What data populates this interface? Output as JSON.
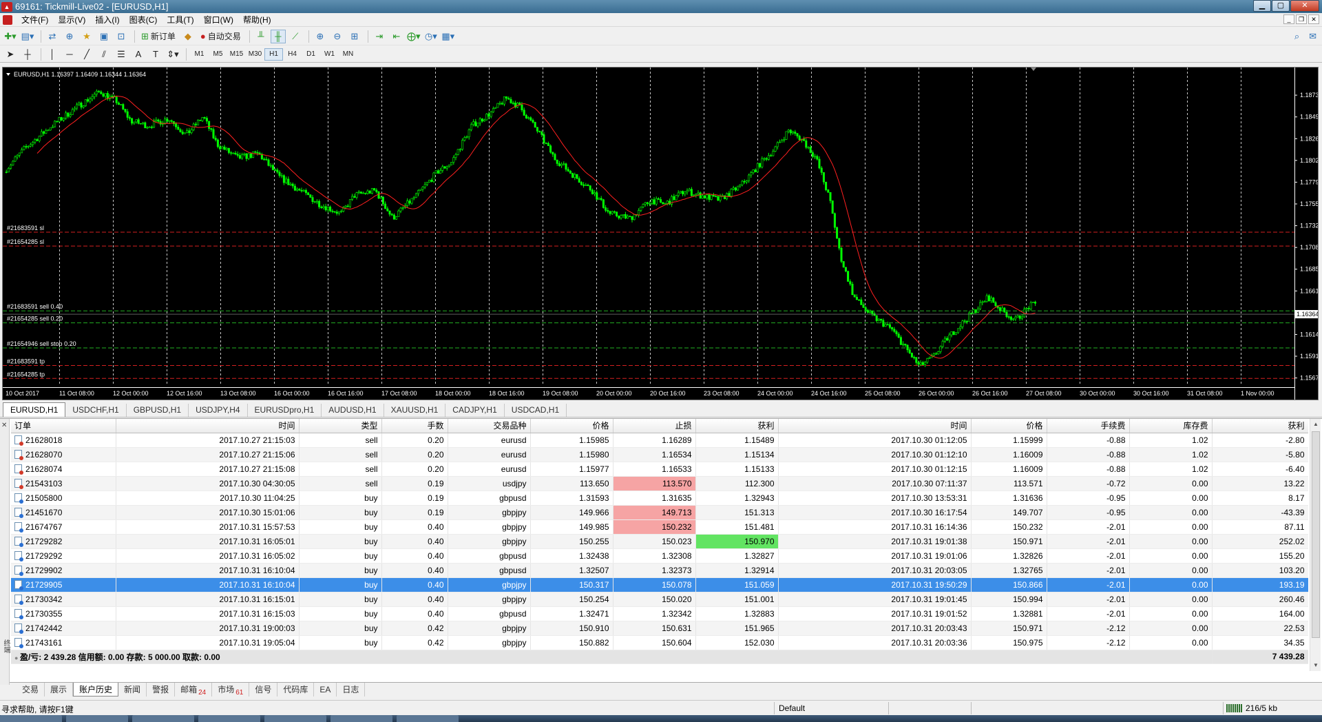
{
  "window": {
    "title": "69161: Tickmill-Live02 - [EURUSD,H1]",
    "icon": "mt4-icon",
    "controls": [
      "minimize",
      "maximize",
      "close"
    ]
  },
  "menu": [
    "文件(F)",
    "显示(V)",
    "插入(I)",
    "图表(C)",
    "工具(T)",
    "窗口(W)",
    "帮助(H)"
  ],
  "toolbar": {
    "new_order_label": "新订单",
    "autotrade_label": "自动交易",
    "timeframes": [
      "M1",
      "M5",
      "M15",
      "M30",
      "H1",
      "H4",
      "D1",
      "W1",
      "MN"
    ],
    "active_timeframe": "H1"
  },
  "chart": {
    "header": "EURUSD,H1  1.16397 1.16409 1.16344 1.16364",
    "current_price": "1.16364",
    "price_labels": [
      "1.18730",
      "1.18495",
      "1.18260",
      "1.18025",
      "1.17790",
      "1.17555",
      "1.17320",
      "1.17085",
      "1.16850",
      "1.16615",
      "1.16380",
      "1.16145",
      "1.15910",
      "1.15675"
    ],
    "time_labels": [
      "10 Oct 2017",
      "11 Oct 08:00",
      "12 Oct 00:00",
      "12 Oct 16:00",
      "13 Oct 08:00",
      "16 Oct 00:00",
      "16 Oct 16:00",
      "17 Oct 08:00",
      "18 Oct 00:00",
      "18 Oct 16:00",
      "19 Oct 08:00",
      "20 Oct 00:00",
      "20 Oct 16:00",
      "23 Oct 08:00",
      "24 Oct 00:00",
      "24 Oct 16:00",
      "25 Oct 08:00",
      "26 Oct 00:00",
      "26 Oct 16:00",
      "27 Oct 08:00",
      "30 Oct 00:00",
      "30 Oct 16:00",
      "31 Oct 08:00",
      "1 Nov 00:00"
    ],
    "order_lines": [
      {
        "label": "#21683591 sl",
        "price": 1.1725,
        "color": "#d42020"
      },
      {
        "label": "#21654285 sl",
        "price": 1.171,
        "color": "#d42020"
      },
      {
        "label": "#21683591 sell 0.40",
        "price": 1.164,
        "color": "#22b022"
      },
      {
        "label": "#21654285 sell 0.20",
        "price": 1.1627,
        "color": "#22b022"
      },
      {
        "label": "#21654946 sell stop 0.20",
        "price": 1.16,
        "color": "#22b022"
      },
      {
        "label": "#21683591 tp",
        "price": 1.1581,
        "color": "#d42020"
      },
      {
        "label": "#21654285 tp",
        "price": 1.1567,
        "color": "#d42020"
      }
    ],
    "candle_color": "#00ff00",
    "ma_color": "#ff2020"
  },
  "chart_tabs": [
    "EURUSD,H1",
    "USDCHF,H1",
    "GBPUSD,H1",
    "USDJPY,H4",
    "EURUSDpro,H1",
    "AUDUSD,H1",
    "XAUUSD,H1",
    "CADJPY,H1",
    "USDCAD,H1"
  ],
  "active_chart_tab": 0,
  "history": {
    "columns": [
      "订单",
      "时间",
      "类型",
      "手数",
      "交易品种",
      "价格",
      "止损",
      "获利",
      "时间",
      "价格",
      "手续费",
      "库存费",
      "获利"
    ],
    "rows": [
      {
        "order": "21628018",
        "open_time": "2017.10.27 21:15:03",
        "type": "sell",
        "lots": "0.20",
        "symbol": "eurusd",
        "open_price": "1.15985",
        "sl": "1.16289",
        "tp": "1.15489",
        "close_time": "2017.10.30 01:12:05",
        "close_price": "1.15999",
        "commission": "-0.88",
        "swap": "1.02",
        "profit": "-2.80",
        "sl_hit": false,
        "tp_hit": false
      },
      {
        "order": "21628070",
        "open_time": "2017.10.27 21:15:06",
        "type": "sell",
        "lots": "0.20",
        "symbol": "eurusd",
        "open_price": "1.15980",
        "sl": "1.16534",
        "tp": "1.15134",
        "close_time": "2017.10.30 01:12:10",
        "close_price": "1.16009",
        "commission": "-0.88",
        "swap": "1.02",
        "profit": "-5.80",
        "sl_hit": false,
        "tp_hit": false
      },
      {
        "order": "21628074",
        "open_time": "2017.10.27 21:15:08",
        "type": "sell",
        "lots": "0.20",
        "symbol": "eurusd",
        "open_price": "1.15977",
        "sl": "1.16533",
        "tp": "1.15133",
        "close_time": "2017.10.30 01:12:15",
        "close_price": "1.16009",
        "commission": "-0.88",
        "swap": "1.02",
        "profit": "-6.40",
        "sl_hit": false,
        "tp_hit": false
      },
      {
        "order": "21543103",
        "open_time": "2017.10.30 04:30:05",
        "type": "sell",
        "lots": "0.19",
        "symbol": "usdjpy",
        "open_price": "113.650",
        "sl": "113.570",
        "tp": "112.300",
        "close_time": "2017.10.30 07:11:37",
        "close_price": "113.571",
        "commission": "-0.72",
        "swap": "0.00",
        "profit": "13.22",
        "sl_hit": true,
        "tp_hit": false
      },
      {
        "order": "21505800",
        "open_time": "2017.10.30 11:04:25",
        "type": "buy",
        "lots": "0.19",
        "symbol": "gbpusd",
        "open_price": "1.31593",
        "sl": "1.31635",
        "tp": "1.32943",
        "close_time": "2017.10.30 13:53:31",
        "close_price": "1.31636",
        "commission": "-0.95",
        "swap": "0.00",
        "profit": "8.17",
        "sl_hit": false,
        "tp_hit": false
      },
      {
        "order": "21451670",
        "open_time": "2017.10.30 15:01:06",
        "type": "buy",
        "lots": "0.19",
        "symbol": "gbpjpy",
        "open_price": "149.966",
        "sl": "149.713",
        "tp": "151.313",
        "close_time": "2017.10.30 16:17:54",
        "close_price": "149.707",
        "commission": "-0.95",
        "swap": "0.00",
        "profit": "-43.39",
        "sl_hit": true,
        "tp_hit": false
      },
      {
        "order": "21674767",
        "open_time": "2017.10.31 15:57:53",
        "type": "buy",
        "lots": "0.40",
        "symbol": "gbpjpy",
        "open_price": "149.985",
        "sl": "150.232",
        "tp": "151.481",
        "close_time": "2017.10.31 16:14:36",
        "close_price": "150.232",
        "commission": "-2.01",
        "swap": "0.00",
        "profit": "87.11",
        "sl_hit": true,
        "tp_hit": false
      },
      {
        "order": "21729282",
        "open_time": "2017.10.31 16:05:01",
        "type": "buy",
        "lots": "0.40",
        "symbol": "gbpjpy",
        "open_price": "150.255",
        "sl": "150.023",
        "tp": "150.970",
        "close_time": "2017.10.31 19:01:38",
        "close_price": "150.971",
        "commission": "-2.01",
        "swap": "0.00",
        "profit": "252.02",
        "sl_hit": false,
        "tp_hit": true
      },
      {
        "order": "21729292",
        "open_time": "2017.10.31 16:05:02",
        "type": "buy",
        "lots": "0.40",
        "symbol": "gbpusd",
        "open_price": "1.32438",
        "sl": "1.32308",
        "tp": "1.32827",
        "close_time": "2017.10.31 19:01:06",
        "close_price": "1.32826",
        "commission": "-2.01",
        "swap": "0.00",
        "profit": "155.20",
        "sl_hit": false,
        "tp_hit": false
      },
      {
        "order": "21729902",
        "open_time": "2017.10.31 16:10:04",
        "type": "buy",
        "lots": "0.40",
        "symbol": "gbpusd",
        "open_price": "1.32507",
        "sl": "1.32373",
        "tp": "1.32914",
        "close_time": "2017.10.31 20:03:05",
        "close_price": "1.32765",
        "commission": "-2.01",
        "swap": "0.00",
        "profit": "103.20",
        "sl_hit": false,
        "tp_hit": false
      },
      {
        "order": "21729905",
        "open_time": "2017.10.31 16:10:04",
        "type": "buy",
        "lots": "0.40",
        "symbol": "gbpjpy",
        "open_price": "150.317",
        "sl": "150.078",
        "tp": "151.059",
        "close_time": "2017.10.31 19:50:29",
        "close_price": "150.866",
        "commission": "-2.01",
        "swap": "0.00",
        "profit": "193.19",
        "sl_hit": false,
        "tp_hit": false,
        "selected": true
      },
      {
        "order": "21730342",
        "open_time": "2017.10.31 16:15:01",
        "type": "buy",
        "lots": "0.40",
        "symbol": "gbpjpy",
        "open_price": "150.254",
        "sl": "150.020",
        "tp": "151.001",
        "close_time": "2017.10.31 19:01:45",
        "close_price": "150.994",
        "commission": "-2.01",
        "swap": "0.00",
        "profit": "260.46",
        "sl_hit": false,
        "tp_hit": false
      },
      {
        "order": "21730355",
        "open_time": "2017.10.31 16:15:03",
        "type": "buy",
        "lots": "0.40",
        "symbol": "gbpusd",
        "open_price": "1.32471",
        "sl": "1.32342",
        "tp": "1.32883",
        "close_time": "2017.10.31 19:01:52",
        "close_price": "1.32881",
        "commission": "-2.01",
        "swap": "0.00",
        "profit": "164.00",
        "sl_hit": false,
        "tp_hit": false
      },
      {
        "order": "21742442",
        "open_time": "2017.10.31 19:00:03",
        "type": "buy",
        "lots": "0.42",
        "symbol": "gbpjpy",
        "open_price": "150.910",
        "sl": "150.631",
        "tp": "151.965",
        "close_time": "2017.10.31 20:03:43",
        "close_price": "150.971",
        "commission": "-2.12",
        "swap": "0.00",
        "profit": "22.53",
        "sl_hit": false,
        "tp_hit": false
      },
      {
        "order": "21743161",
        "open_time": "2017.10.31 19:05:04",
        "type": "buy",
        "lots": "0.42",
        "symbol": "gbpjpy",
        "open_price": "150.882",
        "sl": "150.604",
        "tp": "152.030",
        "close_time": "2017.10.31 20:03:36",
        "close_price": "150.975",
        "commission": "-2.12",
        "swap": "0.00",
        "profit": "34.35",
        "sl_hit": false,
        "tp_hit": false
      }
    ],
    "summary_text": "盈/亏: 2 439.28  信用额: 0.00  存款: 5 000.00  取款: 0.00",
    "summary_total": "7 439.28"
  },
  "terminal": {
    "side_label": "终端",
    "tabs": [
      {
        "label": "交易",
        "badge": ""
      },
      {
        "label": "展示",
        "badge": ""
      },
      {
        "label": "账户历史",
        "badge": ""
      },
      {
        "label": "新闻",
        "badge": ""
      },
      {
        "label": "警报",
        "badge": ""
      },
      {
        "label": "邮箱",
        "badge": "24"
      },
      {
        "label": "市场",
        "badge": "61"
      },
      {
        "label": "信号",
        "badge": ""
      },
      {
        "label": "代码库",
        "badge": ""
      },
      {
        "label": "EA",
        "badge": ""
      },
      {
        "label": "日志",
        "badge": ""
      }
    ],
    "active_tab": 2
  },
  "status": {
    "help_text": "寻求帮助, 请按F1键",
    "profile": "Default",
    "traffic": "216/5 kb"
  }
}
